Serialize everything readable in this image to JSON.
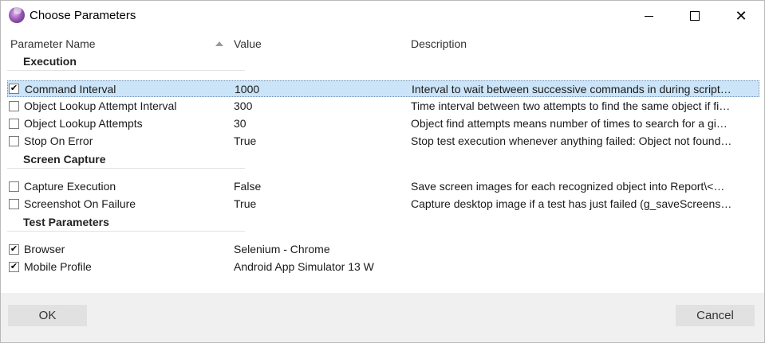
{
  "window": {
    "title": "Choose Parameters",
    "icon": "app-orb-icon"
  },
  "columns": {
    "name": "Parameter Name",
    "value": "Value",
    "description": "Description"
  },
  "groups": [
    {
      "label": "Execution",
      "rows": [
        {
          "checked": true,
          "name": "Command Interval",
          "value": "1000",
          "description": "Interval to wait between successive commands in during script…",
          "selected": true
        },
        {
          "checked": false,
          "name": "Object Lookup Attempt Interval",
          "value": "300",
          "description": "Time interval between two attempts to find the same object if fi…"
        },
        {
          "checked": false,
          "name": "Object Lookup Attempts",
          "value": "30",
          "description": "Object find attempts means number of times to search for a gi…"
        },
        {
          "checked": false,
          "name": "Stop On Error",
          "value": "True",
          "description": "Stop test execution whenever anything failed: Object not found…"
        }
      ]
    },
    {
      "label": "Screen Capture",
      "rows": [
        {
          "checked": false,
          "name": "Capture Execution",
          "value": "False",
          "description": "Save screen images for each recognized object into Report\\<…"
        },
        {
          "checked": false,
          "name": "Screenshot On Failure",
          "value": "True",
          "description": "Capture desktop image if a test has just failed (g_saveScreens…"
        }
      ]
    },
    {
      "label": "Test Parameters",
      "rows": [
        {
          "checked": true,
          "name": "Browser",
          "value": "Selenium - Chrome",
          "description": ""
        },
        {
          "checked": true,
          "name": "Mobile Profile",
          "value": "Android App Simulator 13 W",
          "description": ""
        }
      ]
    }
  ],
  "buttons": {
    "ok": "OK",
    "cancel": "Cancel"
  },
  "check_glyph": "✔"
}
